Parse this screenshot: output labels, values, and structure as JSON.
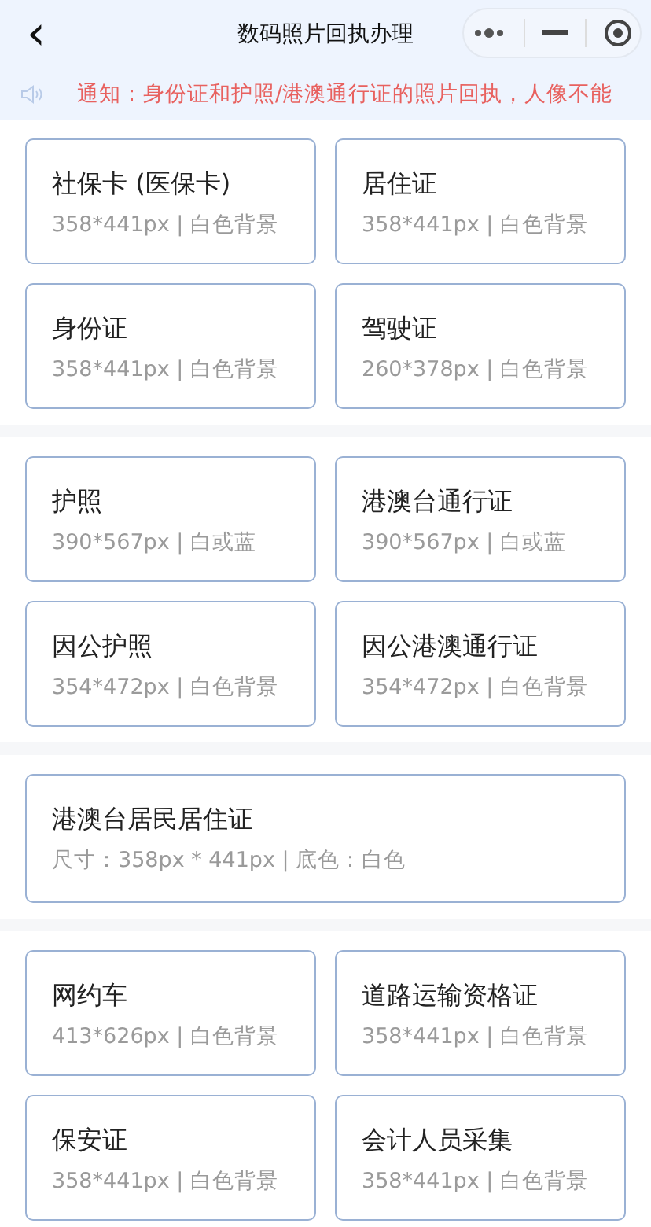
{
  "header": {
    "back": "‹",
    "title": "数码照片回执办理"
  },
  "notice": {
    "text": "通知：身份证和护照/港澳通行证的照片回执，人像不能"
  },
  "groups": [
    {
      "cards": [
        {
          "name": "社保卡 (医保卡)",
          "spec": "358*441px | 白色背景",
          "wide": false
        },
        {
          "name": "居住证",
          "spec": "358*441px | 白色背景",
          "wide": false
        },
        {
          "name": "身份证",
          "spec": "358*441px | 白色背景",
          "wide": false
        },
        {
          "name": "驾驶证",
          "spec": "260*378px | 白色背景",
          "wide": false
        }
      ]
    },
    {
      "cards": [
        {
          "name": "护照",
          "spec": "390*567px | 白或蓝",
          "wide": false
        },
        {
          "name": "港澳台通行证",
          "spec": "390*567px | 白或蓝",
          "wide": false
        },
        {
          "name": "因公护照",
          "spec": "354*472px | 白色背景",
          "wide": false
        },
        {
          "name": "因公港澳通行证",
          "spec": "354*472px | 白色背景",
          "wide": false
        }
      ]
    },
    {
      "cards": [
        {
          "name": "港澳台居民居住证",
          "spec": "尺寸：358px * 441px | 底色：白色",
          "wide": true
        }
      ]
    },
    {
      "cards": [
        {
          "name": "网约车",
          "spec": "413*626px | 白色背景",
          "wide": false
        },
        {
          "name": "道路运输资格证",
          "spec": "358*441px | 白色背景",
          "wide": false
        },
        {
          "name": "保安证",
          "spec": "358*441px | 白色背景",
          "wide": false
        },
        {
          "name": "会计人员采集",
          "spec": "358*441px | 白色背景",
          "wide": false
        }
      ]
    }
  ]
}
